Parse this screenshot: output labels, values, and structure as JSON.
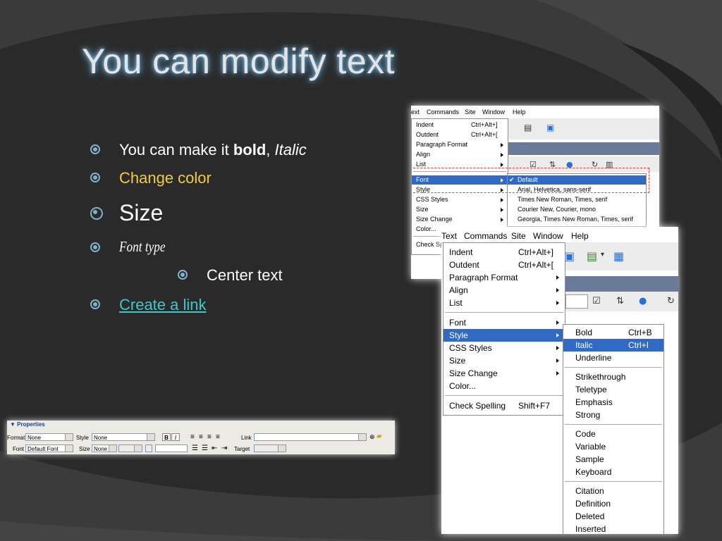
{
  "slide": {
    "title": "You can modify text",
    "bullets": [
      {
        "prefix": "You can make it ",
        "bold": "bold",
        "comma": ", ",
        "italic": "Italic"
      },
      {
        "text": "Change color",
        "color": "#f2cc3a"
      },
      {
        "text": "Size"
      },
      {
        "text": "Font type"
      },
      {
        "text": "Center text"
      },
      {
        "text": "Create a link",
        "color": "#3ec8c8"
      }
    ]
  },
  "screenshot1": {
    "menubar": [
      "Text",
      "Commands",
      "Site",
      "Window",
      "Help"
    ],
    "menubar_visible": [
      "ext",
      "Commands",
      "Site",
      "Window",
      "Help"
    ],
    "menu": [
      {
        "label": "Indent",
        "shortcut": "Ctrl+Alt+]"
      },
      {
        "label": "Outdent",
        "shortcut": "Ctrl+Alt+["
      },
      {
        "label": "Paragraph Format",
        "submenu": true
      },
      {
        "label": "Align",
        "submenu": true
      },
      {
        "label": "List",
        "submenu": true
      },
      {
        "label": "Font",
        "submenu": true,
        "selected": true
      },
      {
        "label": "Style",
        "submenu": true
      },
      {
        "label": "CSS Styles",
        "submenu": true
      },
      {
        "label": "Size",
        "submenu": true
      },
      {
        "label": "Size Change",
        "submenu": true
      },
      {
        "label": "Color..."
      },
      {
        "label": "Check Sp"
      }
    ],
    "font_submenu": [
      {
        "label": "Default",
        "checked": true,
        "selected": true
      },
      {
        "label": "Arial, Helvetica, sans-serif"
      },
      {
        "label": "Times New Roman, Times, serif"
      },
      {
        "label": "Courier New, Courier, mono"
      },
      {
        "label": "Georgia, Times New Roman, Times, serif"
      }
    ],
    "highlight_color": "#e04040"
  },
  "screenshot2": {
    "menubar": [
      "Text",
      "Commands",
      "Site",
      "Window",
      "Help"
    ],
    "menu": [
      {
        "label": "Indent",
        "shortcut": "Ctrl+Alt+]"
      },
      {
        "label": "Outdent",
        "shortcut": "Ctrl+Alt+["
      },
      {
        "label": "Paragraph Format",
        "submenu": true
      },
      {
        "label": "Align",
        "submenu": true
      },
      {
        "label": "List",
        "submenu": true
      },
      {
        "label": "Font",
        "submenu": true
      },
      {
        "label": "Style",
        "submenu": true,
        "selected": true
      },
      {
        "label": "CSS Styles",
        "submenu": true
      },
      {
        "label": "Size",
        "submenu": true
      },
      {
        "label": "Size Change",
        "submenu": true
      },
      {
        "label": "Color..."
      },
      {
        "label": "Check Spelling",
        "shortcut": "Shift+F7"
      }
    ],
    "style_submenu": [
      {
        "label": "Bold",
        "shortcut": "Ctrl+B"
      },
      {
        "label": "Italic",
        "shortcut": "Ctrl+I",
        "selected": true
      },
      {
        "label": "Underline"
      },
      {
        "label": "Strikethrough"
      },
      {
        "label": "Teletype"
      },
      {
        "label": "Emphasis"
      },
      {
        "label": "Strong"
      },
      {
        "label": "Code"
      },
      {
        "label": "Variable"
      },
      {
        "label": "Sample"
      },
      {
        "label": "Keyboard"
      },
      {
        "label": "Citation"
      },
      {
        "label": "Definition"
      },
      {
        "label": "Deleted"
      },
      {
        "label": "Inserted"
      }
    ],
    "selection_color": "#316ac5"
  },
  "properties": {
    "header": "▼ Properties",
    "format_label": "Format",
    "format_value": "None",
    "style_label": "Style",
    "style_value": "None",
    "bold_btn": "B",
    "italic_btn": "I",
    "link_label": "Link",
    "font_label": "Font",
    "font_value": "Default Font",
    "size_label": "Size",
    "size_value": "None",
    "target_label": "Target"
  }
}
